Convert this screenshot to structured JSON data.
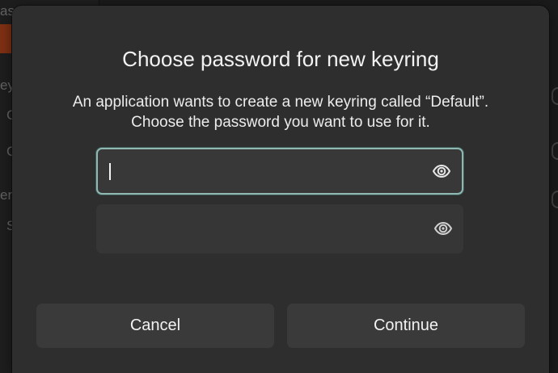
{
  "background": {
    "fragments": [
      "ass",
      "ey",
      "C",
      "C",
      "ert",
      "S"
    ]
  },
  "dialog": {
    "title": "Choose password for new keyring",
    "message_line1": "An application wants to create a new keyring called “Default”.",
    "message_line2": "Choose the password you want to use for it.",
    "password_field": {
      "value": "",
      "placeholder": ""
    },
    "confirm_field": {
      "value": "",
      "placeholder": ""
    },
    "buttons": {
      "cancel": "Cancel",
      "continue": "Continue"
    },
    "icons": {
      "reveal": "eye-icon"
    },
    "colors": {
      "focus_border": "#8fb8b2",
      "surface": "#2e2e2e",
      "field": "#383838",
      "button": "#3a3a3a"
    }
  }
}
